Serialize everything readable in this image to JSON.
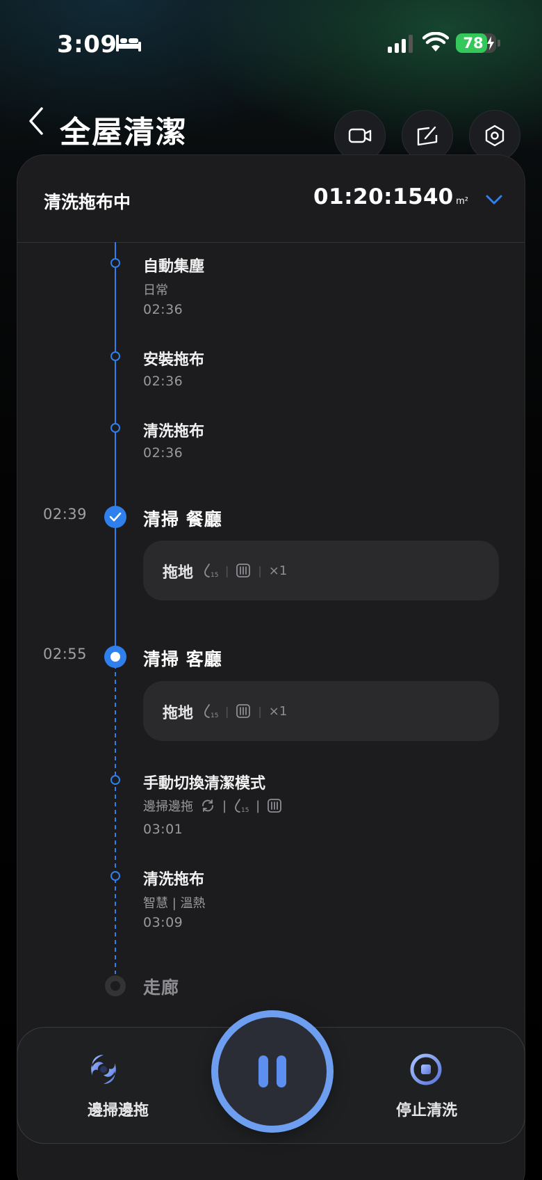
{
  "status_bar": {
    "time": "3:09",
    "battery": "78",
    "battery_level": 0.78
  },
  "header": {
    "title": "全屋清潔"
  },
  "task": {
    "state": "清洗拖布中",
    "duration": "01:20:15",
    "area": "40",
    "area_unit": "m²"
  },
  "timeline": {
    "events": [
      {
        "title": "自動集塵",
        "sub": "日常",
        "time": "02:36"
      },
      {
        "title": "安裝拖布",
        "time": "02:36"
      },
      {
        "title": "清洗拖布",
        "time": "02:36"
      }
    ],
    "rooms": [
      {
        "start": "02:39",
        "name": "清掃 餐廳",
        "mode": "拖地",
        "passes": "×1",
        "status": "done"
      },
      {
        "start": "02:55",
        "name": "清掃 客廳",
        "mode": "拖地",
        "passes": "×1",
        "status": "current"
      }
    ],
    "events_after": [
      {
        "title": "手動切換清潔模式",
        "sub": "邊掃邊拖",
        "time": "03:01"
      },
      {
        "title": "清洗拖布",
        "sub": "智慧 | 溫熱",
        "time": "03:09"
      }
    ],
    "pending_room": "走廊"
  },
  "bottom_bar": {
    "mode_label": "邊掃邊拖",
    "stop_label": "停止清洗"
  },
  "icons": {
    "water-drop-15-icon": "water level",
    "mop-pad-icon": "mop pad",
    "sweep-cycle-icon": "cyclone"
  },
  "colors": {
    "accent": "#2f80ed",
    "battery": "#34c759",
    "card_bg": "#1c1c1e"
  }
}
